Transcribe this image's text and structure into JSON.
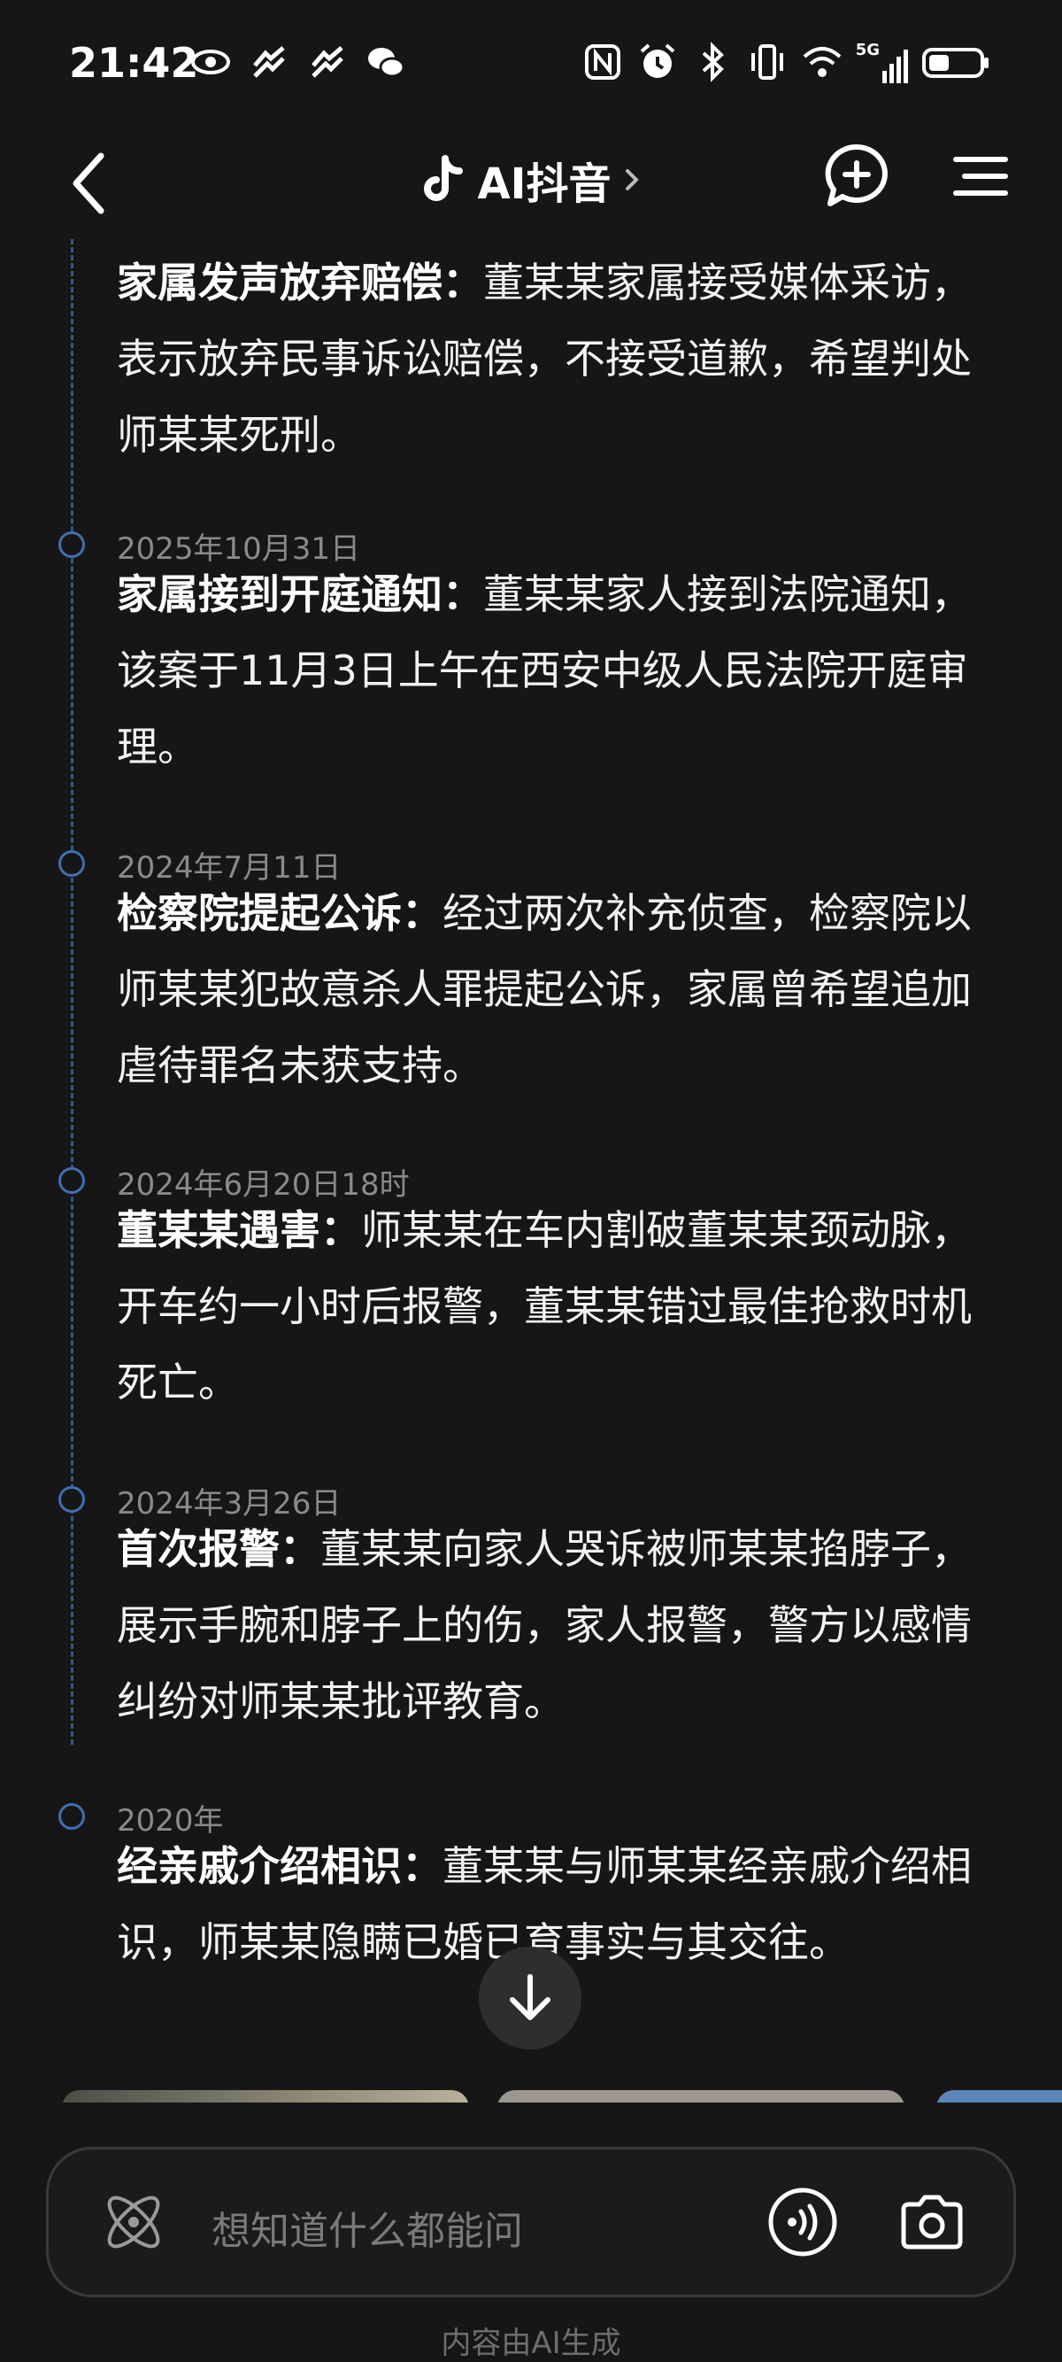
{
  "status_bar": {
    "time": "21:42",
    "network_label": "5G"
  },
  "header": {
    "title": "AI抖音",
    "icons": [
      "back-icon",
      "tiktok-logo-icon",
      "chevron-right-icon",
      "new-chat-icon",
      "menu-icon"
    ]
  },
  "timeline": {
    "items": [
      {
        "date": "",
        "heading": "家属发声放弃赔偿：",
        "body": "董某某家属接受媒体采访，表示放弃民事诉讼赔偿，不接受道歉，希望判处师某某死刑。"
      },
      {
        "date": "2025年10月31日",
        "heading": "家属接到开庭通知：",
        "body": "董某某家人接到法院通知，该案于11月3日上午在西安中级人民法院开庭审理。"
      },
      {
        "date": "2024年7月11日",
        "heading": "检察院提起公诉：",
        "body": "经过两次补充侦查，检察院以师某某犯故意杀人罪提起公诉，家属曾希望追加虐待罪名未获支持。"
      },
      {
        "date": "2024年6月20日18时",
        "heading": "董某某遇害：",
        "body": "师某某在车内割破董某某颈动脉，开车约一小时后报警，董某某错过最佳抢救时机死亡。"
      },
      {
        "date": "2024年3月26日",
        "heading": "首次报警：",
        "body": "董某某向家人哭诉被师某某掐脖子，展示手腕和脖子上的伤，家人报警，警方以感情纠纷对师某某批评教育。"
      },
      {
        "date": "2020年",
        "heading": "经亲戚介绍相识：",
        "body": "董某某与师某某经亲戚介绍相识，师某某隐瞒已婚已育事实与其交往。"
      }
    ]
  },
  "input": {
    "placeholder": "想知道什么都能问"
  },
  "footer": {
    "note": "内容由AI生成"
  },
  "colors": {
    "background": "#161616",
    "timeline_accent": "#3f6fb2",
    "date_text": "#8a8a8a"
  }
}
